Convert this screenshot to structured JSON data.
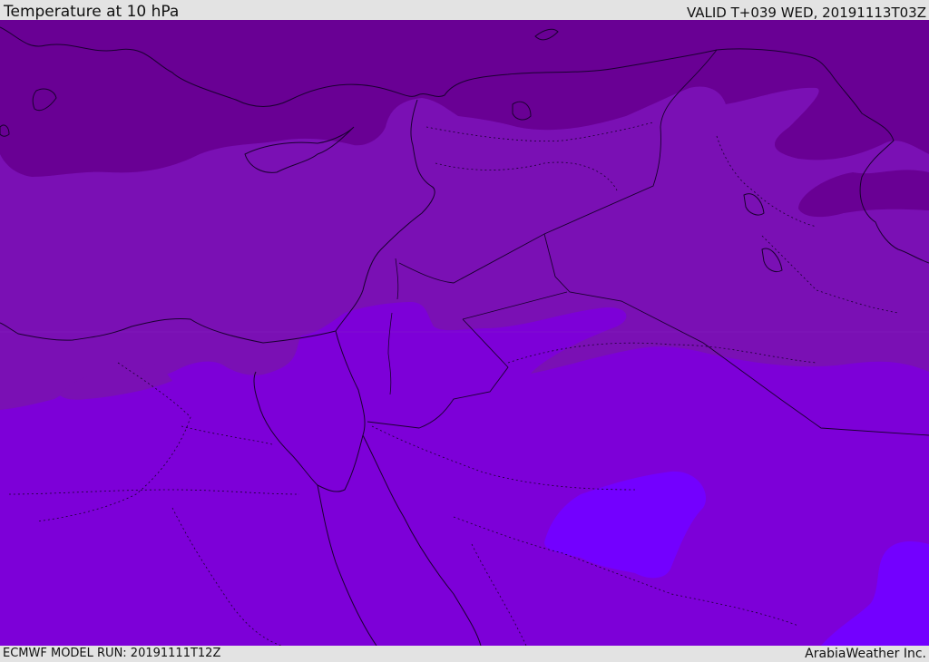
{
  "header": {
    "title": "Temperature at 10 hPa",
    "valid_time": "VALID T+039 WED, 20191113T03Z"
  },
  "footer": {
    "model_run": "ECMWF MODEL RUN: 20191111T12Z",
    "credit": "ArabiaWeather Inc."
  },
  "colors": {
    "band_coldest": "#690094",
    "band_cold": "#7a10b4",
    "band_mid": "#7d00d8",
    "band_warm": "#7300ff"
  }
}
